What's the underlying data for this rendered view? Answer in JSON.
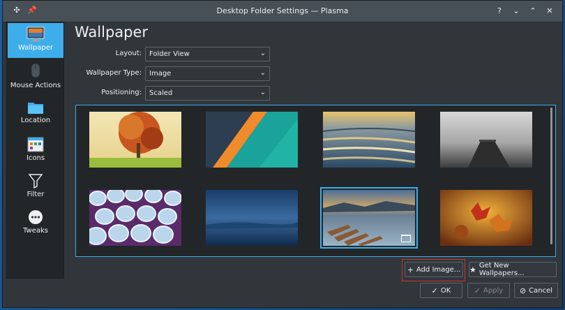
{
  "window": {
    "title": "Desktop Folder Settings — Plasma"
  },
  "titlebar": {
    "pin_icon": "pin-icon",
    "menu_icon": "app-menu-icon"
  },
  "sidebar": {
    "items": [
      {
        "label": "Wallpaper",
        "icon": "monitor-icon",
        "selected": true
      },
      {
        "label": "Mouse Actions",
        "icon": "mouse-icon",
        "selected": false
      },
      {
        "label": "Location",
        "icon": "folder-icon",
        "selected": false
      },
      {
        "label": "Icons",
        "icon": "icons-icon",
        "selected": false
      },
      {
        "label": "Filter",
        "icon": "filter-icon",
        "selected": false
      },
      {
        "label": "Tweaks",
        "icon": "tweaks-icon",
        "selected": false
      }
    ]
  },
  "page": {
    "title": "Wallpaper"
  },
  "form": {
    "layout_label": "Layout:",
    "layout_value": "Folder View",
    "type_label": "Wallpaper Type:",
    "type_value": "Image",
    "positioning_label": "Positioning:",
    "positioning_value": "Scaled"
  },
  "wallpapers": [
    {
      "name": "autumn-tree",
      "selected": false
    },
    {
      "name": "diagonal-stripes",
      "selected": false
    },
    {
      "name": "lake-sunset",
      "selected": false
    },
    {
      "name": "pier-grey",
      "selected": false
    },
    {
      "name": "blue-cups",
      "selected": false
    },
    {
      "name": "misty-blue",
      "selected": false
    },
    {
      "name": "boats-lake",
      "selected": true
    },
    {
      "name": "autumn-leaves",
      "selected": false
    }
  ],
  "buttons": {
    "add_image": "Add Image...",
    "get_new": "Get New Wallpapers...",
    "ok": "OK",
    "apply": "Apply",
    "cancel": "Cancel"
  }
}
